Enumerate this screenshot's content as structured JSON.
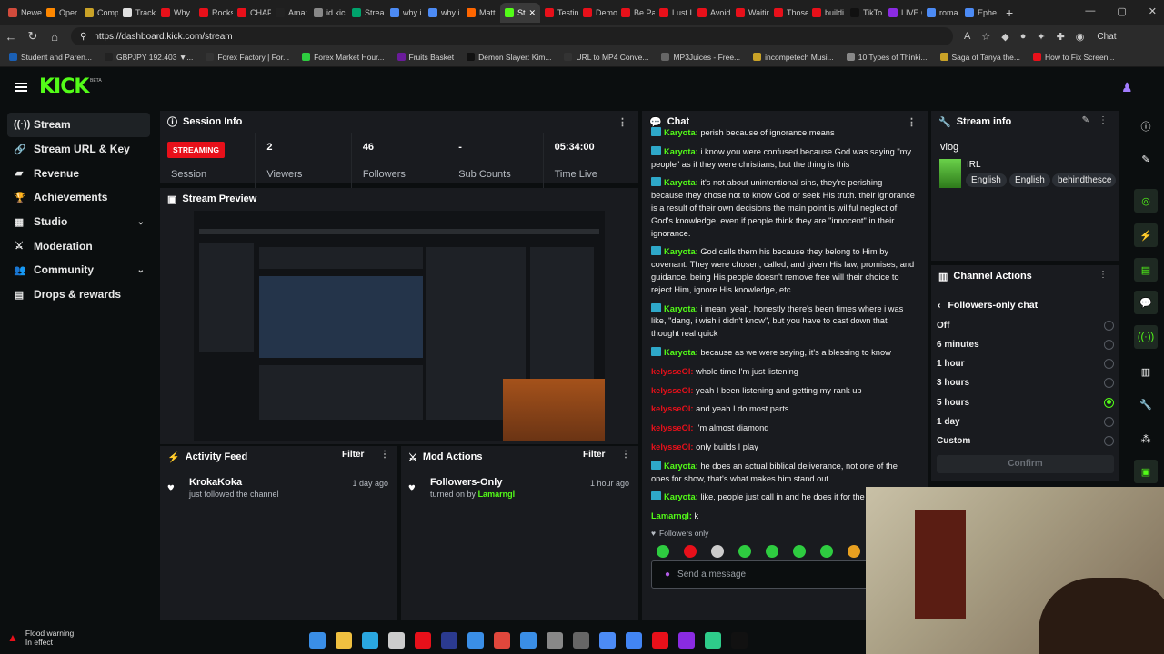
{
  "browser": {
    "tabs": [
      "Newe",
      "Oper",
      "Comp",
      "Track",
      "Why",
      "Rocks",
      "CHAP",
      "Ama:",
      "id.kic",
      "Strea",
      "why i",
      "why i",
      "Matt",
      "St",
      "Testin",
      "Demo",
      "Be Pa",
      "Lust I",
      "Avoid",
      "Waitin",
      "Those",
      "buildi",
      "TikTo",
      "LIVE C",
      "roma",
      "Ephe"
    ],
    "active_tab_index": 13,
    "url": "https://dashboard.kick.com/stream",
    "chat_label": "Chat",
    "bookmarks": [
      "Student and Paren...",
      "GBPJPY 192.403 ▼...",
      "Forex Factory | For...",
      "Forex Market Hour...",
      "Fruits Basket",
      "Demon Slayer: Kim...",
      "URL to MP4 Conve...",
      "MP3Juices - Free...",
      "incompetech Musi...",
      "10 Types of Thinki...",
      "Saga of Tanya the...",
      "How to Fix Screen..."
    ]
  },
  "header": {
    "logo": "KICK",
    "beta": "BETA"
  },
  "sidebar": {
    "items": [
      {
        "label": "Stream",
        "icon": "broadcast-icon",
        "glyph": "((·))"
      },
      {
        "label": "Stream URL & Key",
        "icon": "link-icon",
        "glyph": "🔗"
      },
      {
        "label": "Revenue",
        "icon": "revenue-icon",
        "glyph": "▰"
      },
      {
        "label": "Achievements",
        "icon": "trophy-icon",
        "glyph": "🏆"
      },
      {
        "label": "Studio",
        "icon": "studio-icon",
        "glyph": "▦"
      },
      {
        "label": "Moderation",
        "icon": "moderation-icon",
        "glyph": "⚔"
      },
      {
        "label": "Community",
        "icon": "community-icon",
        "glyph": "👥"
      },
      {
        "label": "Drops & rewards",
        "icon": "drops-icon",
        "glyph": "▤"
      }
    ]
  },
  "session": {
    "title": "Session Info",
    "status": "STREAMING",
    "status_label": "Session",
    "viewers": "2",
    "viewers_label": "Viewers",
    "followers": "46",
    "followers_label": "Followers",
    "subs": "-",
    "subs_label": "Sub Counts",
    "time": "05:34:00",
    "time_label": "Time Live"
  },
  "preview": {
    "title": "Stream Preview"
  },
  "activity": {
    "title": "Activity Feed",
    "filter": "Filter",
    "name": "KrokaKoka",
    "sub": "just followed the channel",
    "time": "1 day ago"
  },
  "modactions": {
    "title": "Mod Actions",
    "filter": "Filter",
    "name": "Followers-Only",
    "sub_prefix": "turned on by",
    "by": "Lamarngl",
    "time": "1 hour ago"
  },
  "chat": {
    "title": "Chat",
    "messages": [
      {
        "user": "Karyota",
        "cls": "user-k",
        "badge": true,
        "text": "perish because of ignorance means"
      },
      {
        "user": "Karyota",
        "cls": "user-k",
        "badge": true,
        "text": "i know you were confused because God was saying \"my people\" as if they were christians, but the thing is this"
      },
      {
        "user": "Karyota",
        "cls": "user-k",
        "badge": true,
        "text": "it's not about unintentional sins, they're perishing because they chose not to know God or seek His truth. their ignorance is a result of their own decisions the main point is willful neglect of God's knowledge, even if people think they are \"innocent\" in their ignorance."
      },
      {
        "user": "Karyota",
        "cls": "user-k",
        "badge": true,
        "text": "God calls them his because they belong to Him by covenant. They were chosen, called, and given His law, promises, and guidance. being His people doesn't remove free will their choice to reject Him, ignore His knowledge, etc"
      },
      {
        "user": "Karyota",
        "cls": "user-k",
        "badge": true,
        "text": "i mean, yeah, honestly there's been times where i was like, \"dang, i wish i didn't know\", but you have to cast down that thought real quick"
      },
      {
        "user": "Karyota",
        "cls": "user-k",
        "badge": true,
        "text": "because as we were saying, it's a blessing to know"
      },
      {
        "user": "kelysseOl",
        "cls": "user-r",
        "badge": false,
        "text": "whole time I'm just listening"
      },
      {
        "user": "kelysseOl",
        "cls": "user-r",
        "badge": false,
        "text": "yeah I been listening and getting my rank up"
      },
      {
        "user": "kelysseOl",
        "cls": "user-r",
        "badge": false,
        "text": "and yeah I do most parts"
      },
      {
        "user": "kelysseOl",
        "cls": "user-r",
        "badge": false,
        "text": "I'm almost diamond"
      },
      {
        "user": "kelysseOl",
        "cls": "user-r",
        "badge": false,
        "text": "only builds I play"
      },
      {
        "user": "Karyota",
        "cls": "user-k",
        "badge": true,
        "text": "he does an actual biblical deliverance, not one of the ones for show, that's what makes him stand out"
      },
      {
        "user": "Karyota",
        "cls": "user-k",
        "badge": true,
        "text": "like, people just call in and he does it for the"
      },
      {
        "user": "Lamarngl",
        "cls": "user-l",
        "badge": false,
        "text": "k"
      }
    ],
    "followers_only": "Followers only",
    "placeholder": "Send a message"
  },
  "streaminfo": {
    "title": "Stream info",
    "category": "vlog",
    "subcategory": "IRL",
    "tags": [
      "English",
      "English",
      "behindthesce"
    ]
  },
  "channelactions": {
    "title": "Channel Actions",
    "sub_title": "Followers-only chat",
    "options": [
      "Off",
      "6 minutes",
      "1 hour",
      "3 hours",
      "5 hours",
      "1 day",
      "Custom"
    ],
    "selected": "5 hours",
    "confirm": "Confirm"
  },
  "status": {
    "flood": "Flood warning",
    "flood_sub": "In effect"
  },
  "colors": {
    "accent": "#53fc18",
    "live": "#e8101a",
    "panel": "#191b1f",
    "bg": "#0b0e0f"
  }
}
